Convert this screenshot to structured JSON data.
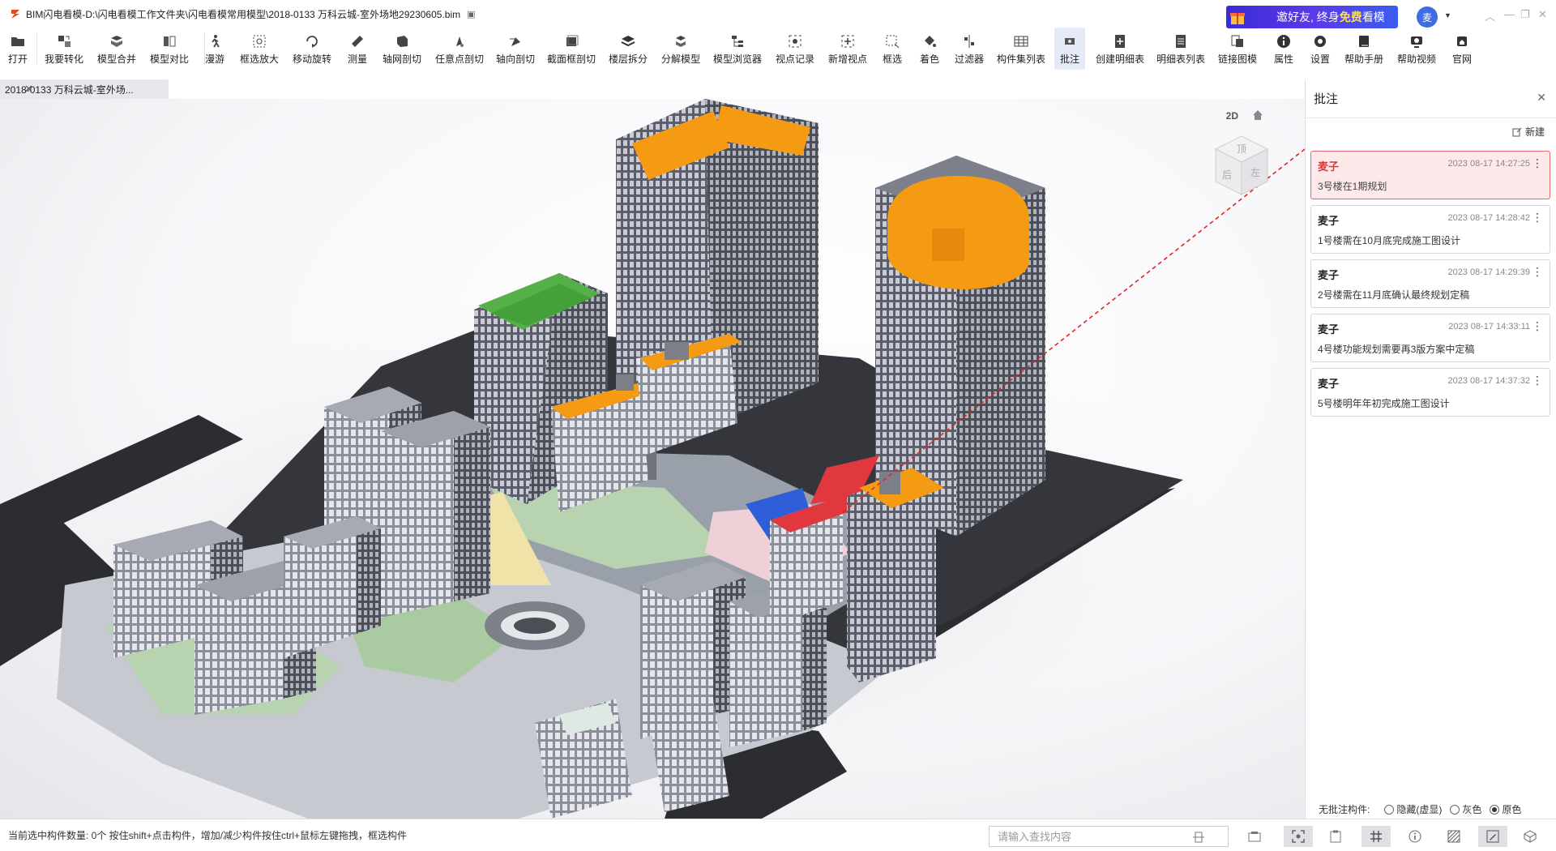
{
  "window": {
    "title": "BIM闪电看模-D:\\闪电看模工作文件夹\\闪电看模常用模型\\2018-0133 万科云城-室外场地29230605.bim",
    "promo": {
      "prefix": "邀好友, 终身",
      "highlight": "免费",
      "suffix": "看模"
    },
    "avatar": "麦"
  },
  "toolbar": [
    {
      "label": "打开",
      "icon": "folder-icon"
    },
    {
      "label": "我要转化",
      "icon": "convert-icon"
    },
    {
      "label": "模型合并",
      "icon": "merge-icon"
    },
    {
      "label": "模型对比",
      "icon": "compare-icon"
    },
    {
      "label": "漫游",
      "icon": "walk-icon"
    },
    {
      "label": "框选放大",
      "icon": "zoom-box-icon"
    },
    {
      "label": "移动旋转",
      "icon": "move-rotate-icon"
    },
    {
      "label": "测量",
      "icon": "ruler-icon"
    },
    {
      "label": "轴网剖切",
      "icon": "grid-section-icon"
    },
    {
      "label": "任意点剖切",
      "icon": "point-section-icon"
    },
    {
      "label": "轴向剖切",
      "icon": "axis-section-icon"
    },
    {
      "label": "截面框剖切",
      "icon": "box-section-icon"
    },
    {
      "label": "楼层拆分",
      "icon": "layers-icon"
    },
    {
      "label": "分解模型",
      "icon": "explode-icon"
    },
    {
      "label": "模型浏览器",
      "icon": "tree-icon"
    },
    {
      "label": "视点记录",
      "icon": "viewpoint-icon"
    },
    {
      "label": "新增视点",
      "icon": "add-viewpoint-icon"
    },
    {
      "label": "框选",
      "icon": "select-box-icon"
    },
    {
      "label": "着色",
      "icon": "paint-bucket-icon"
    },
    {
      "label": "过滤器",
      "icon": "filter-icon"
    },
    {
      "label": "构件集列表",
      "icon": "table-icon"
    },
    {
      "label": "批注",
      "icon": "annotate-icon"
    },
    {
      "label": "创建明细表",
      "icon": "create-schedule-icon"
    },
    {
      "label": "明细表列表",
      "icon": "schedule-list-icon"
    },
    {
      "label": "链接图模",
      "icon": "link-icon"
    },
    {
      "label": "属性",
      "icon": "info-icon"
    },
    {
      "label": "设置",
      "icon": "gear-icon"
    },
    {
      "label": "帮助手册",
      "icon": "manual-icon"
    },
    {
      "label": "帮助视频",
      "icon": "video-icon"
    },
    {
      "label": "官网",
      "icon": "home-icon"
    }
  ],
  "tab": {
    "label": "2018-0133 万科云城-室外场..."
  },
  "viewport": {
    "mode_2d": "2D",
    "cube_top": "顶",
    "cube_front": "后",
    "cube_right": "左"
  },
  "panel": {
    "title": "批注",
    "new_label": "新建",
    "notes": [
      {
        "author": "麦子",
        "time": "2023 08-17 14:27:25",
        "text": "3号楼在1期规划",
        "selected": true
      },
      {
        "author": "麦子",
        "time": "2023 08-17 14:28:42",
        "text": "1号楼需在10月底完成施工图设计"
      },
      {
        "author": "麦子",
        "time": "2023 08-17 14:29:39",
        "text": "2号楼需在11月底确认最终规划定稿"
      },
      {
        "author": "麦子",
        "time": "2023 08-17 14:33:11",
        "text": "4号楼功能规划需要再3版方案中定稿"
      },
      {
        "author": "麦子",
        "time": "2023 08-17 14:37:32",
        "text": "5号楼明年年初完成施工图设计"
      }
    ],
    "legend_label": "无批注构件:",
    "legend_options": [
      "隐藏(虚显)",
      "灰色",
      "原色"
    ],
    "legend_selected": "原色"
  },
  "status": {
    "selection_text": "当前选中构件数量: 0个 按住shift+点击构件，增加/减少构件按住ctrl+鼠标左键拖拽，框选构件",
    "search_placeholder": "请输入查找内容"
  },
  "colors": {
    "accent": "#3d6de0",
    "selected_note_bg": "#fde9ea",
    "selected_note_border": "#e46b6b",
    "roof_orange": "#f59a13",
    "roof_red": "#e0383e",
    "roof_green": "#56b04a"
  }
}
